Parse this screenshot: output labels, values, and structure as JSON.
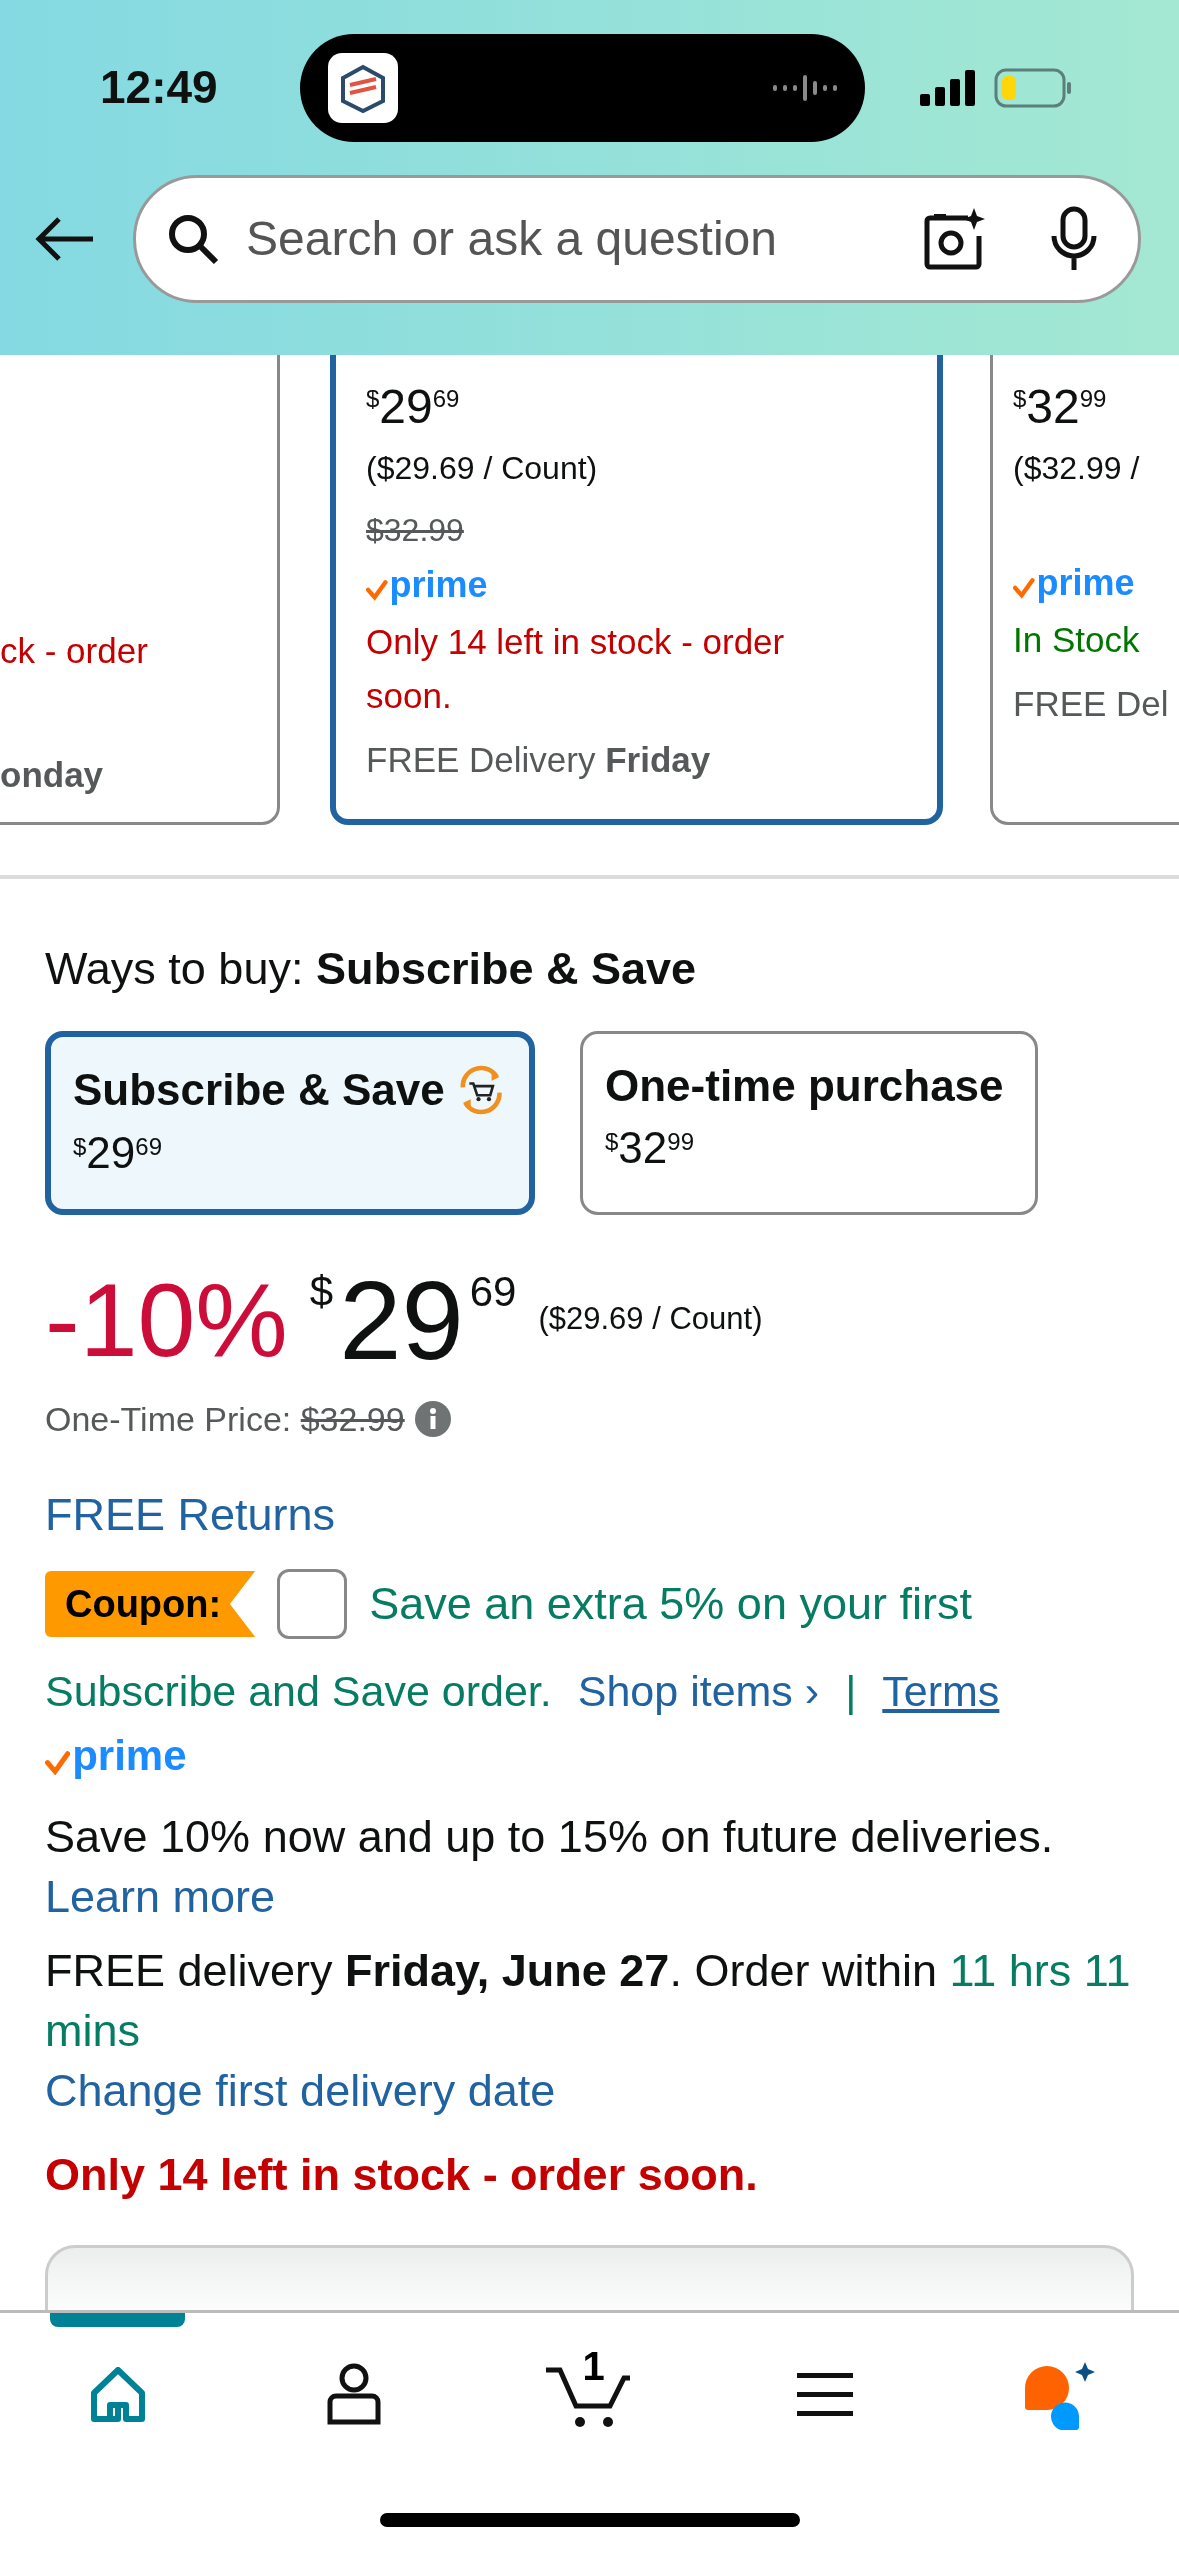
{
  "status_bar": {
    "time": "12:49"
  },
  "search": {
    "placeholder": "Search or ask a question"
  },
  "product_cards": [
    {
      "kind": "cut-left",
      "selected": false,
      "stock": "ck - order",
      "low_stock": true,
      "delivery_day": "onday"
    },
    {
      "kind": "full",
      "selected": true,
      "price_symbol": "$",
      "price_whole": "29",
      "price_fraction": "69",
      "unit_price": "($29.69 / Count)",
      "list_price": "$32.99",
      "prime": "prime",
      "stock": "Only 14 left in stock - order soon.",
      "low_stock": true,
      "delivery": "FREE Delivery",
      "delivery_day": "Friday"
    },
    {
      "kind": "cut-right",
      "selected": false,
      "price_symbol": "$",
      "price_whole": "32",
      "price_fraction": "99",
      "unit_price": "($32.99 /",
      "prime": "prime",
      "stock": "In Stock",
      "low_stock": false,
      "delivery": "FREE Del"
    }
  ],
  "ways_to_buy": {
    "label": "Ways to buy:",
    "value": "Subscribe & Save"
  },
  "purchase_options": [
    {
      "kind": "subscribe",
      "title": "Subscribe & Save",
      "price_symbol": "$",
      "price_whole": "29",
      "price_fraction": "69",
      "selected": true
    },
    {
      "kind": "one-time",
      "title": "One-time purchase",
      "price_symbol": "$",
      "price_whole": "32",
      "price_fraction": "99",
      "selected": false
    }
  ],
  "price": {
    "discount": "-10%",
    "symbol": "$",
    "whole": "29",
    "fraction": "69",
    "unit_price": "($29.69 / Count)"
  },
  "one_time_price": {
    "label": "One-Time Price:",
    "value": "$32.99"
  },
  "free_returns": "FREE Returns",
  "coupon": {
    "badge": "Coupon:",
    "checked": false,
    "text": "Save an extra 5% on your first",
    "text_continued": "Subscribe and Save order.",
    "shop_link": "Shop items ›",
    "separator": "|",
    "terms": "Terms"
  },
  "prime_logo": "prime",
  "subscribe_note": "Save 10% now and up to 15% on future deliveries.",
  "learn_more": "Learn more",
  "delivery": {
    "text": "FREE delivery **Friday, June 27**. Order within",
    "countdown": "11 hrs 11 mins"
  },
  "change_date": "Change first delivery date",
  "stock_warning": "Only 14 left in stock - order soon.",
  "bottom_nav": [
    {
      "kind": "home",
      "selected": true
    },
    {
      "kind": "account",
      "selected": false
    },
    {
      "kind": "cart",
      "selected": false,
      "count": "1"
    },
    {
      "kind": "menu",
      "selected": false
    },
    {
      "kind": "assistant",
      "selected": false
    }
  ]
}
